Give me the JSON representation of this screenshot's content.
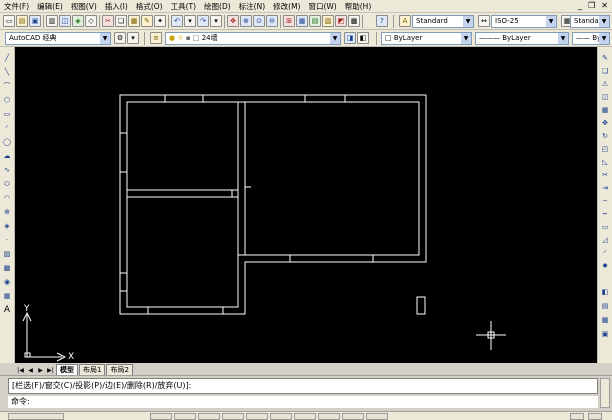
{
  "menubar": {
    "items": [
      "文件(F)",
      "编辑(E)",
      "视图(V)",
      "插入(I)",
      "格式(O)",
      "工具(T)",
      "绘图(D)",
      "标注(N)",
      "修改(M)",
      "窗口(W)",
      "帮助(H)"
    ]
  },
  "toolbar1": {
    "text_style": "Standard",
    "dim_style": "ISO-25",
    "table_style": "Standard"
  },
  "toolbar2": {
    "workspace": "AutoCAD 经典",
    "layer": "24墙",
    "color": "ByLayer",
    "linetype": "ByLayer",
    "lineweight": "ByLayer"
  },
  "ucs": {
    "y_label": "Y",
    "x_label": "X"
  },
  "tabs": {
    "model": "模型",
    "layout1": "布局1",
    "layout2": "布局2"
  },
  "command": {
    "history": "[栏选(F)/窗交(C)/投影(P)/边(E)/删除(R)/放弃(U)]:",
    "prompt": "命令:"
  },
  "colors": {
    "canvas": "#000000",
    "drawing_lines": "#ffffff",
    "chrome": "#ece9d8"
  }
}
